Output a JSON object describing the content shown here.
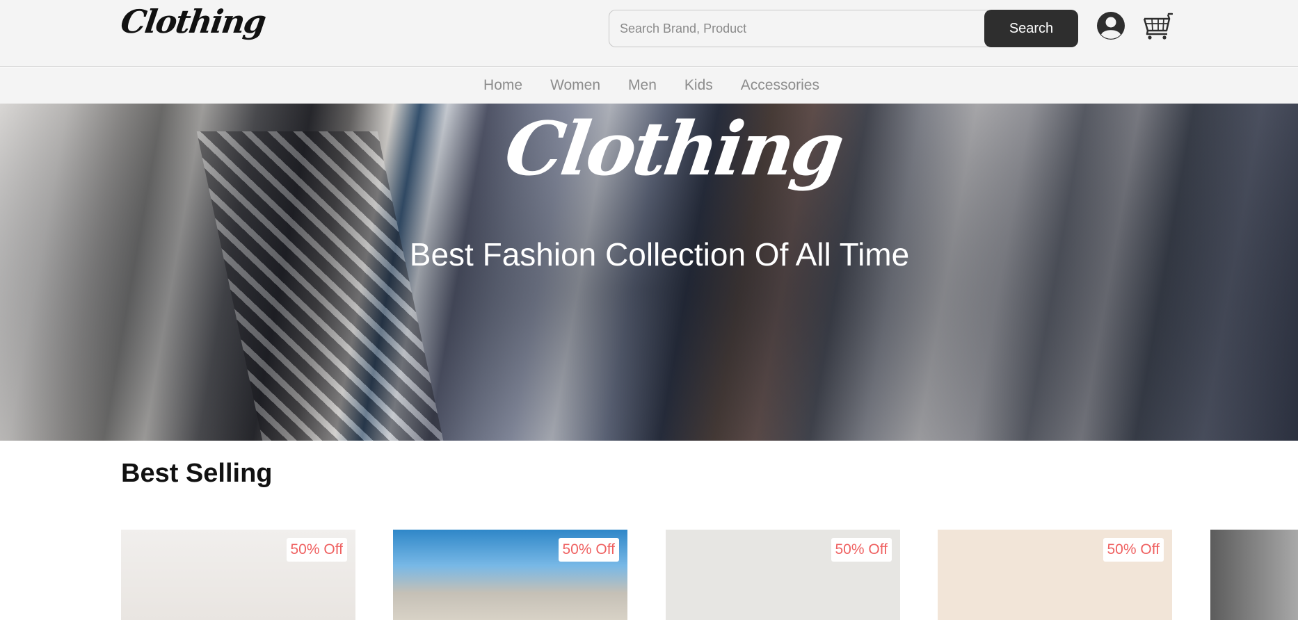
{
  "header": {
    "logo_text": "Clothing",
    "search": {
      "placeholder": "Search Brand, Product",
      "button_label": "Search"
    },
    "icons": {
      "account": "user-icon",
      "cart": "cart-icon"
    }
  },
  "nav": {
    "items": [
      {
        "label": "Home"
      },
      {
        "label": "Women"
      },
      {
        "label": "Men"
      },
      {
        "label": "Kids"
      },
      {
        "label": "Accessories"
      }
    ]
  },
  "hero": {
    "logo_text": "Clothing",
    "tagline": "Best Fashion Collection Of All Time"
  },
  "best_selling": {
    "title": "Best Selling",
    "products": [
      {
        "badge": "50% Off"
      },
      {
        "badge": "50% Off"
      },
      {
        "badge": "50% Off"
      },
      {
        "badge": "50% Off"
      }
    ]
  },
  "colors": {
    "header_bg": "#f4f4f4",
    "search_button_bg": "#2e2e2e",
    "nav_text": "#8c8c8c",
    "badge_text": "#ef6060"
  }
}
